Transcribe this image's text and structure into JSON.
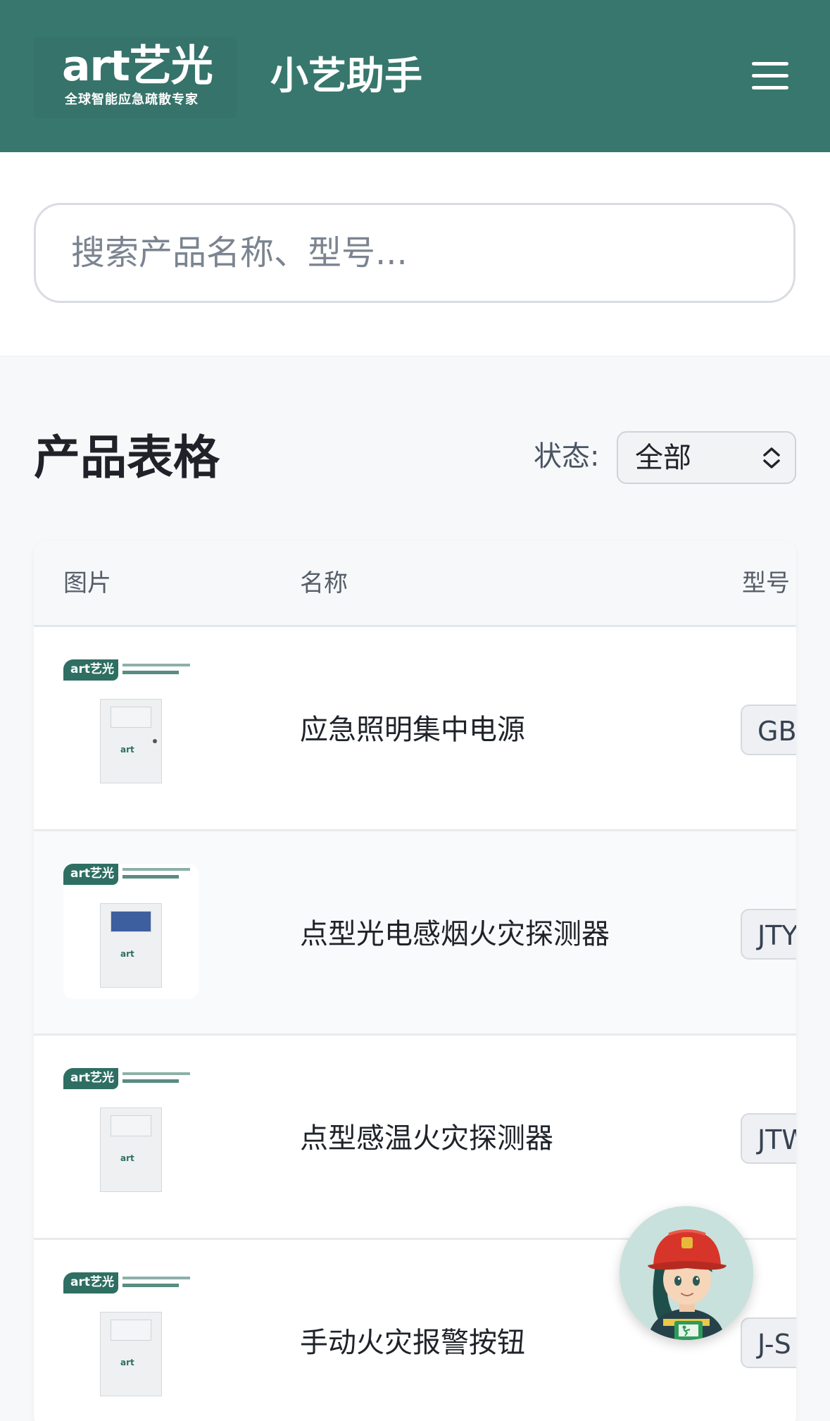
{
  "header": {
    "logo_main": "art艺光",
    "logo_tagline": "全球智能应急疏散专家",
    "app_title": "小艺助手",
    "menu_icon": "hamburger-menu-icon"
  },
  "search": {
    "placeholder": "搜索产品名称、型号...",
    "value": ""
  },
  "section": {
    "title": "产品表格",
    "status_label": "状态:",
    "status_value": "全部"
  },
  "table": {
    "columns": [
      "图片",
      "名称",
      "型号"
    ],
    "rows": [
      {
        "name": "应急照明集中电源",
        "model": "GB"
      },
      {
        "name": "点型光电感烟火灾探测器",
        "model": "JTY"
      },
      {
        "name": "点型感温火灾探测器",
        "model": "JTW"
      },
      {
        "name": "手动火灾报警按钮",
        "model": "J-S"
      }
    ]
  },
  "thumb_brand": "art艺光",
  "colors": {
    "header_bg": "#37776d",
    "page_bg": "#f7f8fa"
  },
  "assistant": {
    "icon": "firefighter-assistant-avatar-icon"
  }
}
